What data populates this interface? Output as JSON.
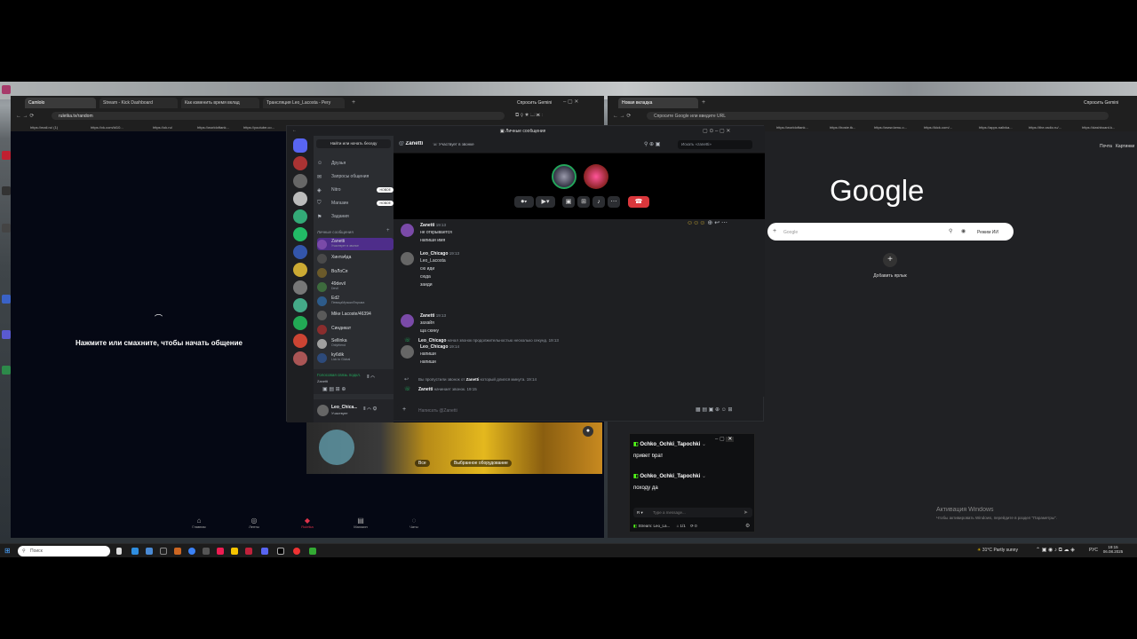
{
  "left_browser": {
    "tabs": [
      {
        "label": "Camlolo",
        "active": true
      },
      {
        "label": "Stream - Kick Dashboard",
        "active": false
      },
      {
        "label": "Как изменить время вклад",
        "active": false
      },
      {
        "label": "Трансляция Leo_Lacosta - Регу",
        "active": false
      }
    ],
    "ask_gemini": "Спросить Gemini",
    "url": "ruletka.tv/random",
    "bookmarks": [
      "https://mail.ru/ (1)",
      "https://vk.com/id10...",
      "https://ok.ru/",
      "https://worldoftank...",
      "https://youtube.co..."
    ],
    "prompt_text": "Нажмите или смахните, чтобы начать общение",
    "bottom_nav": [
      {
        "label": "Главная"
      },
      {
        "label": "Ленты"
      },
      {
        "label": "Ruletka"
      },
      {
        "label": "Магазин"
      },
      {
        "label": "Чаты"
      }
    ],
    "video_badges": [
      "Все",
      "Выбранное оборудование"
    ]
  },
  "discord": {
    "window_title": "Личные сообщения",
    "search_button": "Найти или начать беседу",
    "nav": [
      {
        "label": "Друзья"
      },
      {
        "label": "Запросы общения"
      },
      {
        "label": "Nitro",
        "badge": "НОВОЕ"
      },
      {
        "label": "Магазин",
        "badge": "НОВОЕ"
      },
      {
        "label": "Задания"
      }
    ],
    "dm_header": "Личные сообщения",
    "dms": [
      {
        "name": "Zanetti",
        "sub": "Участвует в звонке",
        "color": "#7a4aa8"
      },
      {
        "name": "Хинта4да",
        "sub": "",
        "color": "#4a4a4a"
      },
      {
        "name": "ВоЛоСя",
        "sub": "",
        "color": "#6b5a2a"
      },
      {
        "name": "49devil",
        "sub": "Devil",
        "color": "#3d6b3d"
      },
      {
        "name": "Ed2",
        "sub": "ПевицаМузыкиТюрьма",
        "color": "#2d5b8a"
      },
      {
        "name": "Mike Lacoste/46394",
        "sub": "",
        "color": "#5a5a5a"
      },
      {
        "name": "Синдикат",
        "sub": "",
        "color": "#8a2d2d"
      },
      {
        "name": "Sellinka",
        "sub": "Onlyfriend",
        "color": "#a0a0a0"
      },
      {
        "name": "ky6dik",
        "sub": "Lick to Global",
        "color": "#2d4a7a"
      }
    ],
    "voice_status": "Голосовая связь подкл.",
    "voice_channel": "Zanetti",
    "user_name": "Leo_Chica...",
    "user_sub": "Участвует",
    "chat_header_name": "Zanetti",
    "chat_header_status": "Участвует в звонке",
    "search_placeholder": "Искать «zanetti»",
    "messages": [
      {
        "author": "Zanetti",
        "time": "19:13",
        "lines": [
          "не открывается",
          "напиши имя"
        ],
        "av": "#7a4aa8"
      },
      {
        "author": "Leo_Chicago",
        "time": "19:13",
        "lines": [
          "Leo_Lacosta",
          "сю иди",
          "сюда",
          "заиди"
        ],
        "av": "#666"
      },
      {
        "author": "Zanetti",
        "time": "19:13",
        "lines": [
          "захайя",
          "ща скину"
        ],
        "av": "#7a4aa8"
      },
      {
        "author": "Leo_Chicago",
        "time": "19:14",
        "lines": [
          "напиши",
          "напиши"
        ],
        "av": "#666"
      }
    ],
    "call_event": {
      "author": "Leo_Chicago",
      "text": "начал звонок продолжительностью несколько секунд.",
      "time": "19:13"
    },
    "missed_call": {
      "prefix": "Вы пропустили звонок от",
      "name": "Zanetti",
      "suffix": "который длился минута.",
      "time": "19:14"
    },
    "call_start": {
      "name": "Zanetti",
      "text": "начинает звонок.",
      "time": "19:15"
    },
    "composer_placeholder": "Написать @Zanetti"
  },
  "right_browser": {
    "tab": "Новая вкладка",
    "ask_gemini": "Спросить Gemini",
    "url_placeholder": "Спросите Google или введите URL",
    "bookmarks": [
      "https://mail.ru/",
      "https://worldoftank...",
      "https://hoste.tk...",
      "https://www.kenu.o...",
      "https://kick.com/...",
      "https://apps.nalivka...",
      "https://the-radio.ru/...",
      "https://dashboard.k..."
    ],
    "top_links": [
      "Почта",
      "Картинки"
    ],
    "logo": "Google",
    "search_placeholder": "Google",
    "ai_mode": "Режим ИИ",
    "add_shortcut": "Добавить ярлык",
    "activation_title": "Активация Windows",
    "activation_sub": "Чтобы активировать Windows, перейдите в раздел \"Параметры\"."
  },
  "kick_chat": {
    "messages": [
      {
        "user": "Ochko_Ochki_Tapochki",
        "text": "привет брат"
      },
      {
        "user": "Ochko_Ochki_Tapochki",
        "text": "походу да"
      }
    ],
    "input_placeholder": "Type a message...",
    "stream_label": "Stream: Leo_La...",
    "viewers": "1/1",
    "count": "0"
  },
  "taskbar": {
    "search": "Поиск",
    "weather": "31°C",
    "weather_text": "Partly sunny",
    "lang": "РУС",
    "time": "19:15",
    "date": "06.08.2025"
  }
}
